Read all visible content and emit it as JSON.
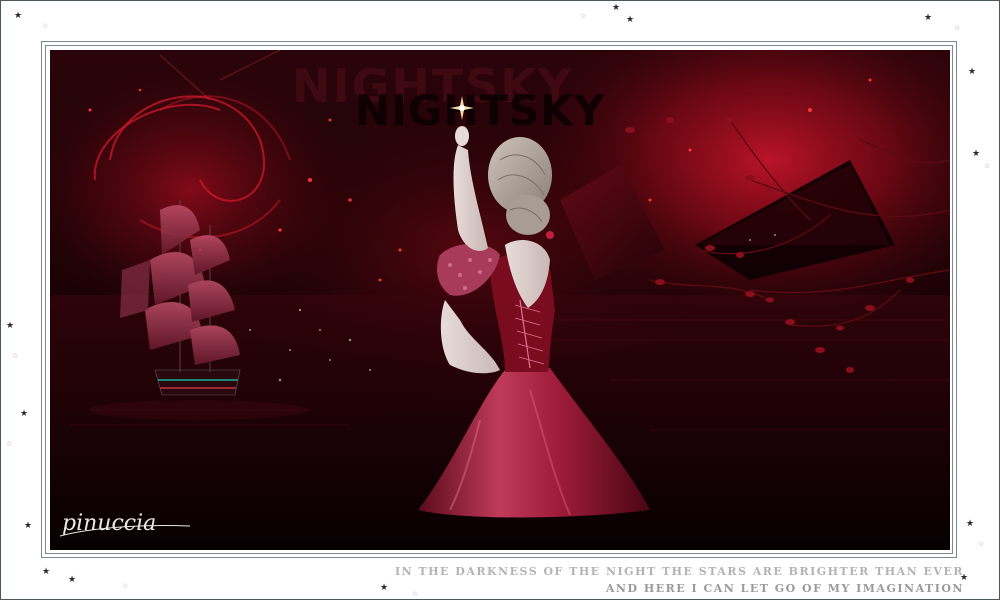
{
  "artwork": {
    "title_text": "NIGHTSKY",
    "signature": "pinuccia"
  },
  "caption": {
    "line1": "IN THE DARKNESS OF THE NIGHT THE STARS ARE BRIGHTER THAN EVER",
    "line2": "AND HERE I CAN LET GO OF MY IMAGINATION"
  },
  "colors": {
    "frame": "#4a5a5a",
    "background_dark": "#1a0205",
    "nebula_red": "#b3101e",
    "dress_red": "#b0243f",
    "caption_gray": "#b3b3b3"
  }
}
